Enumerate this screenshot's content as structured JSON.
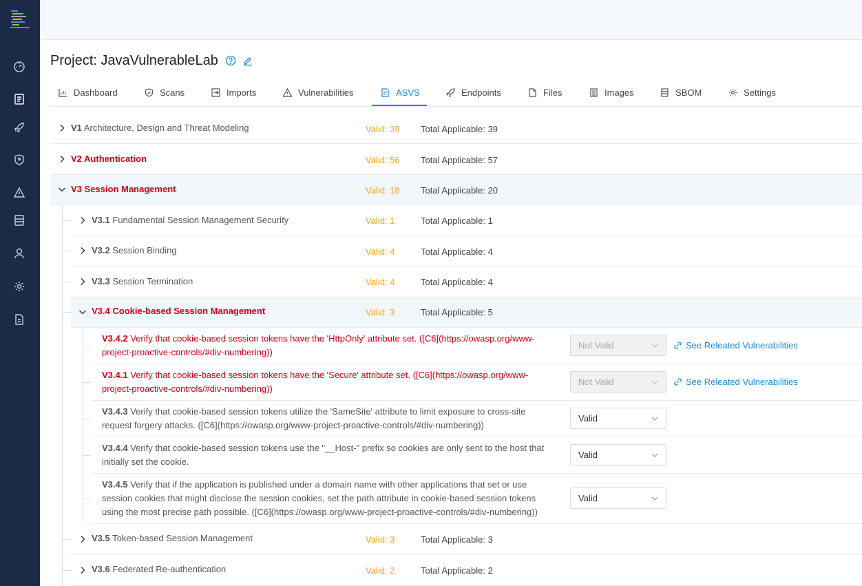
{
  "project": {
    "title": "Project: JavaVulnerableLab"
  },
  "tabs": [
    {
      "label": "Dashboard",
      "icon": "chart-icon"
    },
    {
      "label": "Scans",
      "icon": "shield-icon"
    },
    {
      "label": "Imports",
      "icon": "import-icon"
    },
    {
      "label": "Vulnerabilities",
      "icon": "warning-icon"
    },
    {
      "label": "ASVS",
      "icon": "asvs-icon",
      "active": true
    },
    {
      "label": "Endpoints",
      "icon": "rocket-icon"
    },
    {
      "label": "Files",
      "icon": "file-icon"
    },
    {
      "label": "Images",
      "icon": "image-icon"
    },
    {
      "label": "SBOM",
      "icon": "sbom-icon"
    },
    {
      "label": "Settings",
      "icon": "gear-icon"
    }
  ],
  "sections": [
    {
      "code": "V1",
      "name": "Architecture, Design and Threat Modeling",
      "valid": "Valid: 39",
      "total": "Total Applicable: 39"
    },
    {
      "code": "V2",
      "name": "Authentication",
      "valid": "Valid: 56",
      "total": "Total Applicable: 57"
    },
    {
      "code": "V3",
      "name": "Session Management",
      "valid": "Valid: 18",
      "total": "Total Applicable: 20"
    }
  ],
  "subsections": [
    {
      "code": "V3.1",
      "name": "Fundamental Session Management Security",
      "valid": "Valid: 1",
      "total": "Total Applicable: 1"
    },
    {
      "code": "V3.2",
      "name": "Session Binding",
      "valid": "Valid: 4",
      "total": "Total Applicable: 4"
    },
    {
      "code": "V3.3",
      "name": "Session Termination",
      "valid": "Valid: 4",
      "total": "Total Applicable: 4"
    },
    {
      "code": "V3.4",
      "name": "Cookie-based Session Management",
      "valid": "Valid: 3",
      "total": "Total Applicable: 5"
    },
    {
      "code": "V3.5",
      "name": "Token-based Session Management",
      "valid": "Valid: 3",
      "total": "Total Applicable: 3"
    },
    {
      "code": "V3.6",
      "name": "Federated Re-authentication",
      "valid": "Valid: 2",
      "total": "Total Applicable: 2"
    }
  ],
  "requirements": [
    {
      "code": "V3.4.2",
      "text": "Verify that cookie-based session tokens have the 'HttpOnly' attribute set. ([C6](https://owasp.org/www-project-proactive-controls/#div-numbering))",
      "status": "Not Valid",
      "link": "See Releated Vulnerabilities"
    },
    {
      "code": "V3.4.1",
      "text": "Verify that cookie-based session tokens have the 'Secure' attribute set. ([C6](https://owasp.org/www-project-proactive-controls/#div-numbering))",
      "status": "Not Valid",
      "link": "See Releated Vulnerabilities"
    },
    {
      "code": "V3.4.3",
      "text": "Verify that cookie-based session tokens utilize the 'SameSite' attribute to limit exposure to cross-site request forgery attacks. ([C6](https://owasp.org/www-project-proactive-controls/#div-numbering))",
      "status": "Valid"
    },
    {
      "code": "V3.4.4",
      "text": "Verify that cookie-based session tokens use the \"__Host-\" prefix so cookies are only sent to the host that initially set the cookie.",
      "status": "Valid"
    },
    {
      "code": "V3.4.5",
      "text": "Verify that if the application is published under a domain name with other applications that set or use session cookies that might disclose the session cookies, set the path attribute in cookie-based session tokens using the most precise path possible. ([C6](https://owasp.org/www-project-proactive-controls/#div-numbering))",
      "status": "Valid"
    }
  ],
  "colors": {
    "sidebar": "#1b2a47",
    "accent": "#1c8ad6",
    "failing": "#d0021b",
    "valid_count": "#f5a623"
  }
}
